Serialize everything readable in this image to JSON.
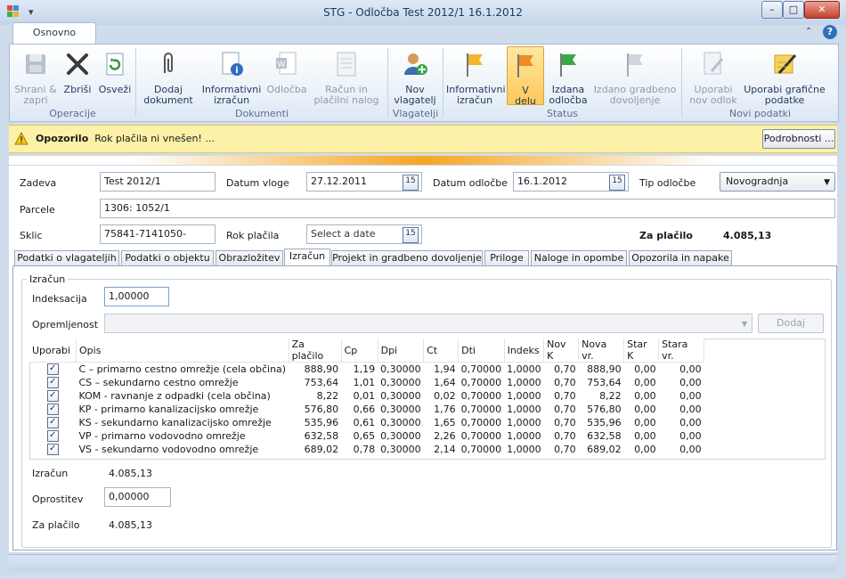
{
  "window": {
    "title": "STG - Odločba Test 2012/1 16.1.2012"
  },
  "ribbon": {
    "tab": "Osnovno",
    "groups": [
      {
        "label": "Operacije"
      },
      {
        "label": "Dokumenti"
      },
      {
        "label": "Vlagatelji"
      },
      {
        "label": "Status"
      },
      {
        "label": "Novi podatki"
      }
    ],
    "buttons": {
      "shrani": [
        "Shrani &",
        "zapri"
      ],
      "zbrisi": [
        "Zbriši",
        ""
      ],
      "osvezi": [
        "Osveži",
        ""
      ],
      "dodaj_dok": [
        "Dodaj",
        "dokument"
      ],
      "info_izracun": [
        "Informativni",
        "izračun"
      ],
      "odlocba": [
        "Odločba",
        ""
      ],
      "racun": [
        "Račun in",
        "plačilni nalog"
      ],
      "nov_vlag": [
        "Nov",
        "vlagatelj"
      ],
      "st_info": [
        "Informativni",
        "izračun"
      ],
      "st_vdelu": [
        "V",
        "delu"
      ],
      "st_izdana": [
        "Izdana",
        "odločba"
      ],
      "st_izdano_gd": [
        "Izdano gradbeno",
        "dovoljenje"
      ],
      "uporabi_nov": [
        "Uporabi",
        "nov odlok"
      ],
      "uporabi_graf": [
        "Uporabi grafične",
        "podatke"
      ]
    }
  },
  "warning": {
    "label": "Opozorilo",
    "text": "Rok plačila ni vnešen! ...",
    "button": "Podrobnosti ..."
  },
  "form": {
    "zadeva_label": "Zadeva",
    "zadeva": "Test 2012/1",
    "datum_vloge_label": "Datum vloge",
    "datum_vloge": "27.12.2011",
    "datum_odlocbe_label": "Datum odločbe",
    "datum_odlocbe": "16.1.2012",
    "tip_label": "Tip odločbe",
    "tip": "Novogradnja",
    "parcele_label": "Parcele",
    "parcele": "1306: 1052/1",
    "sklic_label": "Sklic",
    "sklic": "75841-7141050-",
    "rok_label": "Rok plačila",
    "rok_placeholder": "Select a date",
    "za_placilo_label": "Za plačilo",
    "za_placilo": "4.085,13"
  },
  "tabs": [
    "Podatki o vlagateljih",
    "Podatki o objektu",
    "Obrazložitev",
    "Izračun",
    "Projekt in gradbeno dovoljenje",
    "Priloge",
    "Naloge in opombe",
    "Opozorila in napake"
  ],
  "izracun": {
    "group": "Izračun",
    "indeksacija_label": "Indeksacija",
    "indeksacija": "1,00000",
    "opremljenost_label": "Opremljenost",
    "dodaj": "Dodaj",
    "columns": [
      "Uporabi",
      "Opis",
      "Za plačilo",
      "Cp",
      "Dpi",
      "Ct",
      "Dti",
      "Indeks",
      "Nov K",
      "Nova vr.",
      "Star K",
      "Stara vr."
    ],
    "rows": [
      [
        "C – primarno cestno omrežje (cela občina)",
        "888,90",
        "1,19",
        "0,30000",
        "1,94",
        "0,70000",
        "1,0000",
        "0,70",
        "888,90",
        "0,00",
        "0,00"
      ],
      [
        "CS – sekundarno cestno omrežje",
        "753,64",
        "1,01",
        "0,30000",
        "1,64",
        "0,70000",
        "1,0000",
        "0,70",
        "753,64",
        "0,00",
        "0,00"
      ],
      [
        "KOM - ravnanje z odpadki (cela občina)",
        "8,22",
        "0,01",
        "0,30000",
        "0,02",
        "0,70000",
        "1,0000",
        "0,70",
        "8,22",
        "0,00",
        "0,00"
      ],
      [
        "KP - primarno kanalizacijsko omrežje",
        "576,80",
        "0,66",
        "0,30000",
        "1,76",
        "0,70000",
        "1,0000",
        "0,70",
        "576,80",
        "0,00",
        "0,00"
      ],
      [
        "KS - sekundarno kanalizacijsko omrežje",
        "535,96",
        "0,61",
        "0,30000",
        "1,65",
        "0,70000",
        "1,0000",
        "0,70",
        "535,96",
        "0,00",
        "0,00"
      ],
      [
        "VP - primarno vodovodno omrežje",
        "632,58",
        "0,65",
        "0,30000",
        "2,26",
        "0,70000",
        "1,0000",
        "0,70",
        "632,58",
        "0,00",
        "0,00"
      ],
      [
        "VS - sekundarno vodovodno omrežje",
        "689,02",
        "0,78",
        "0,30000",
        "2,14",
        "0,70000",
        "1,0000",
        "0,70",
        "689,02",
        "0,00",
        "0,00"
      ]
    ],
    "izracun_label": "Izračun",
    "izracun_value": "4.085,13",
    "oprostitev_label": "Oprostitev",
    "oprostitev": "0,00000",
    "za_placilo_label": "Za plačilo",
    "za_placilo_value": "4.085,13"
  }
}
